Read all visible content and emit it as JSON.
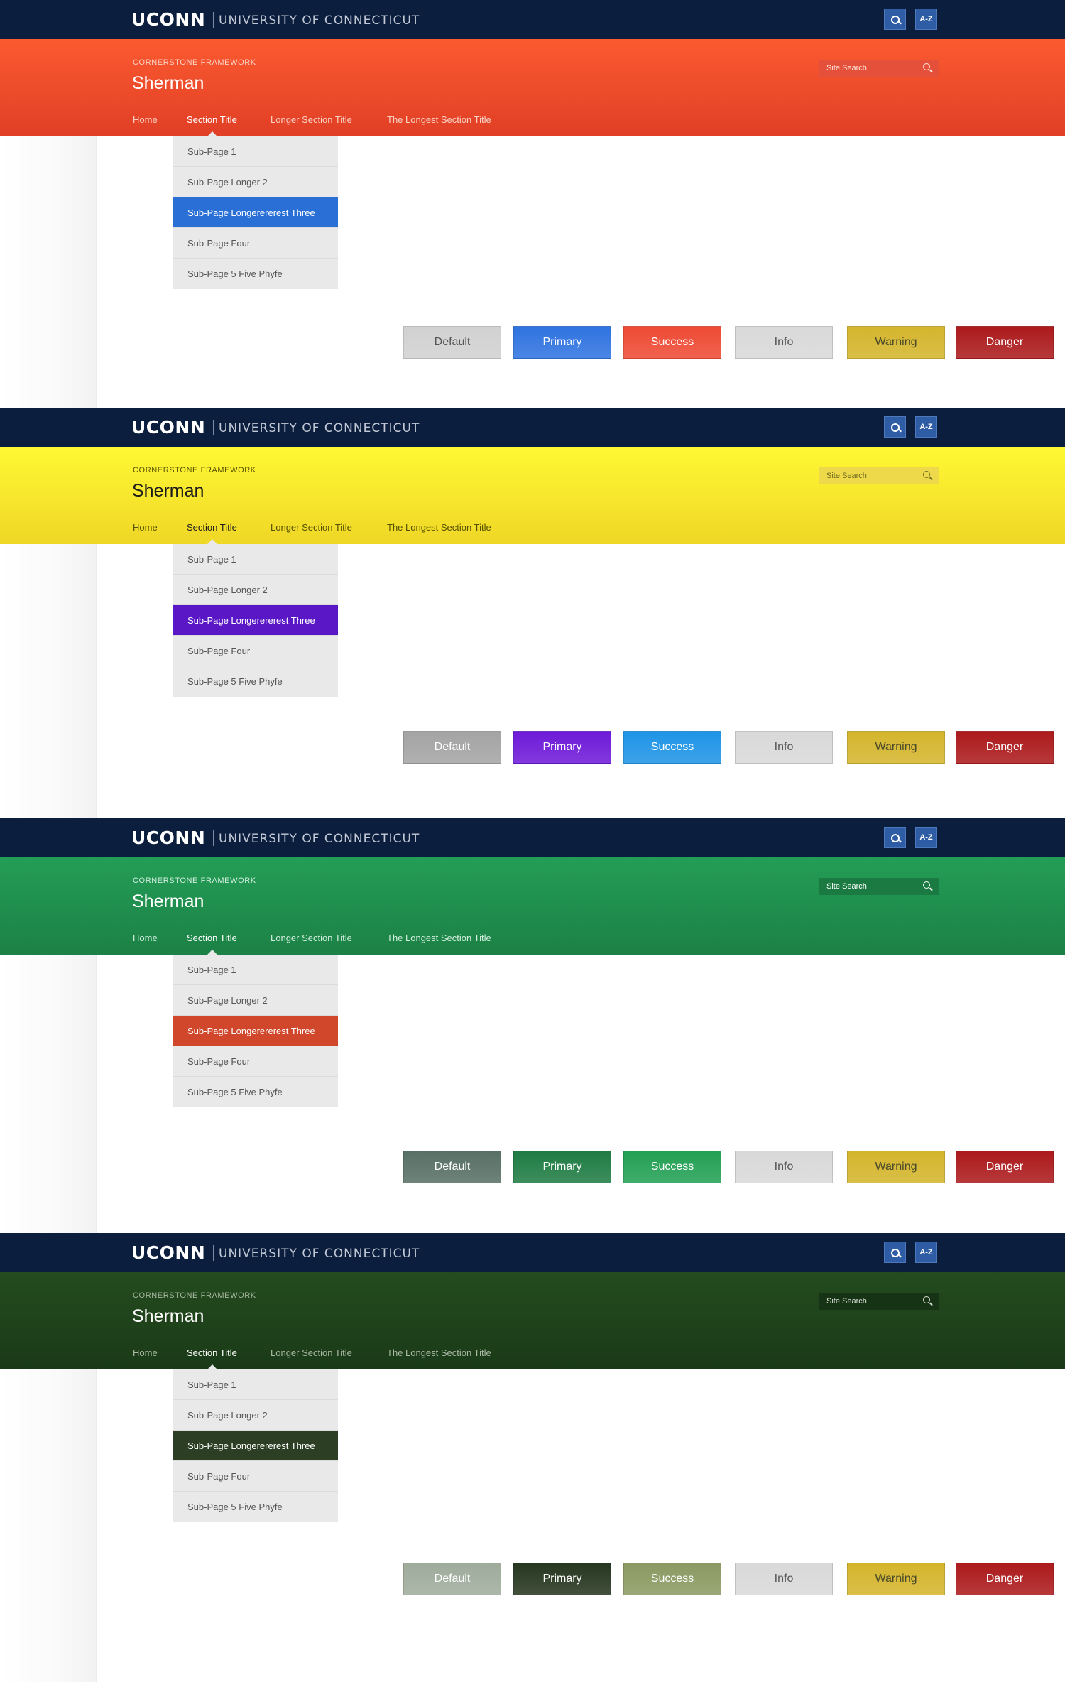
{
  "header": {
    "logo": "UCONN",
    "university": "UNIVERSITY OF CONNECTICUT",
    "search_icon": "search-icon",
    "az_label": "A-Z",
    "framework": "CORNERSTONE FRAMEWORK",
    "site_name": "Sherman",
    "search_placeholder": "Site Search"
  },
  "nav": [
    "Home",
    "Section Title",
    "Longer Section Title",
    "The Longest Section Title"
  ],
  "nav_active": "Section Title",
  "dropdown": [
    "Sub-Page 1",
    "Sub-Page Longer 2",
    "Sub-Page Longerererest Three",
    "Sub-Page Four",
    "Sub-Page 5 Five Phyfe"
  ],
  "dropdown_active": "Sub-Page Longerererest Three",
  "buttons": [
    "Default",
    "Primary",
    "Success",
    "Info",
    "Warning",
    "Danger"
  ],
  "colors": {
    "topbar": "#0c1e3e",
    "top_button": "#2e5da5",
    "dropdown_bg": "#e9e9e9",
    "info": "#d9d9d9",
    "warning": "#d4b52c",
    "danger": "#ac1a1c"
  },
  "themes": [
    {
      "name": "orange",
      "band_top": "#fb5a30",
      "band_bottom": "#e13f26",
      "text": "#ffffff",
      "subtext": "#f9d2c4",
      "search_bg": "#e4503a",
      "search_text": "#ffe7de",
      "active_dropdown": "#2a6fd6",
      "default_btn": "#d1d1d1",
      "default_text": "#555555",
      "primary_btn": "#2f73e0",
      "primary_text": "#ffffff",
      "success_btn": "#ee4a34",
      "success_text": "#ffffff"
    },
    {
      "name": "yellow",
      "band_top": "#fff834",
      "band_bottom": "#efd726",
      "text": "#1c1c1c",
      "subtext": "#555000",
      "search_bg": "#eed94a",
      "search_text": "#6f6a20",
      "active_dropdown": "#5a17c6",
      "default_btn": "#a4a4a4",
      "default_text": "#ffffff",
      "primary_btn": "#6e1ad8",
      "primary_text": "#ffffff",
      "success_btn": "#1f94e6",
      "success_text": "#ffffff"
    },
    {
      "name": "green",
      "band_top": "#239d56",
      "band_bottom": "#1c8146",
      "text": "#ffffff",
      "subtext": "#d3efdf",
      "search_bg": "#1b7a41",
      "search_text": "#ffffff",
      "active_dropdown": "#d0472b",
      "default_btn": "#587066",
      "default_text": "#ffffff",
      "primary_btn": "#1f7c43",
      "primary_text": "#ffffff",
      "success_btn": "#23a054",
      "success_text": "#ffffff"
    },
    {
      "name": "darkgreen",
      "band_top": "#244b1f",
      "band_bottom": "#1a3a17",
      "text": "#ffffff",
      "subtext": "#a8b8a4",
      "search_bg": "#173315",
      "search_text": "#d7dfd5",
      "active_dropdown": "#2c3f24",
      "default_btn": "#9fac9c",
      "default_text": "#ffffff",
      "primary_btn": "#26361f",
      "primary_text": "#ffffff",
      "success_btn": "#8b9a62",
      "success_text": "#ffffff"
    }
  ]
}
